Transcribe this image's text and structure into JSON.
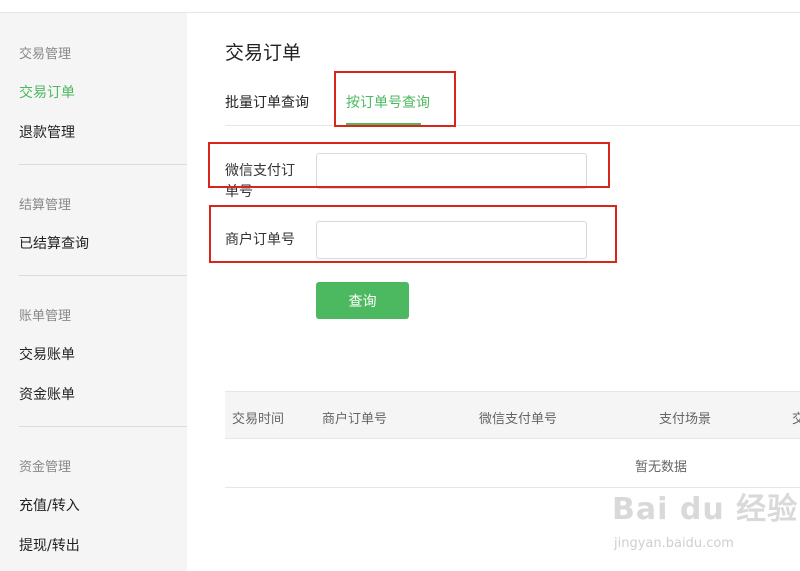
{
  "sidebar": {
    "groups": [
      {
        "title": "交易管理",
        "items": [
          "交易订单",
          "退款管理"
        ]
      },
      {
        "title": "结算管理",
        "items": [
          "已结算查询"
        ]
      },
      {
        "title": "账单管理",
        "items": [
          "交易账单",
          "资金账单"
        ]
      },
      {
        "title": "资金管理",
        "items": [
          "充值/转入",
          "提现/转出"
        ]
      }
    ],
    "active_item": "交易订单"
  },
  "main": {
    "title": "交易订单",
    "tabs": [
      {
        "label": "批量订单查询",
        "active": false
      },
      {
        "label": "按订单号查询",
        "active": true
      }
    ],
    "form": {
      "wx_order_label": "微信支付订单号",
      "wx_order_value": "",
      "merchant_order_label": "商户订单号",
      "merchant_order_value": "",
      "query_button": "查询"
    },
    "table": {
      "columns": [
        "交易时间",
        "商户订单号",
        "微信支付单号",
        "支付场景",
        "交"
      ],
      "empty_text": "暂无数据"
    }
  },
  "watermark": {
    "logo": "Bai du 经验",
    "url": "jingyan.baidu.com"
  },
  "colors": {
    "accent": "#4cb960",
    "annotation": "#d9261c",
    "sidebar_bg": "#f5f5f5"
  }
}
